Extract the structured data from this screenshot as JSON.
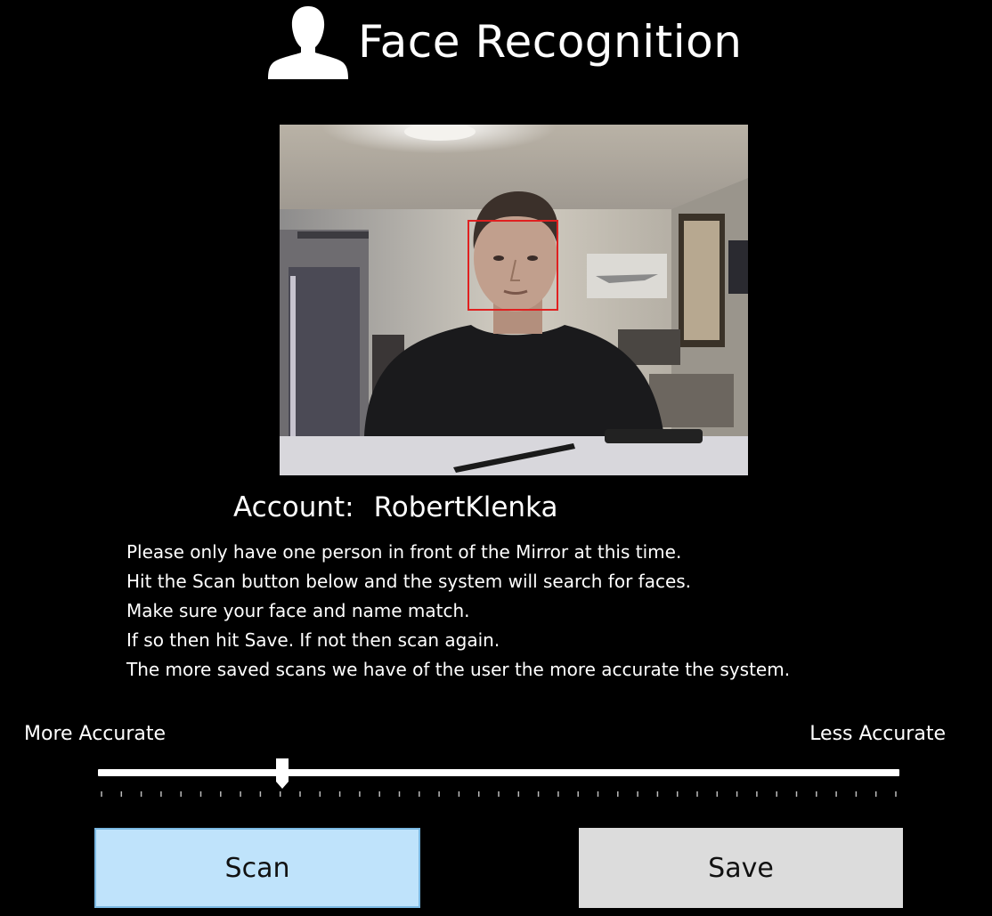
{
  "header": {
    "icon": "user-silhouette-icon",
    "title": "Face Recognition"
  },
  "camera": {
    "face_box_color": "#e02020"
  },
  "account": {
    "label": "Account:",
    "value": "RobertKlenka"
  },
  "instructions": [
    "Please only have one person in front of the Mirror at this time.",
    "Hit the Scan button below and the system will search for faces.",
    "Make sure your face and name match.",
    "If so then hit Save. If not then scan again.",
    "The more saved scans we have of the user the more accurate the system."
  ],
  "accuracy": {
    "left_label": "More Accurate",
    "right_label": "Less Accurate",
    "slider_value": 0.23,
    "tick_count": 41
  },
  "buttons": {
    "scan_label": "Scan",
    "save_label": "Save",
    "scan_color": "#bfe3fb",
    "save_color": "#dcdcdc"
  }
}
